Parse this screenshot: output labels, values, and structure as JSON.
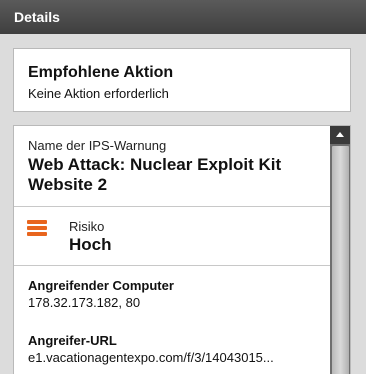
{
  "header": {
    "title": "Details"
  },
  "recommended_action": {
    "title": "Empfohlene Aktion",
    "value": "Keine Aktion erforderlich"
  },
  "details": {
    "warning_label": "Name der IPS-Warnung",
    "warning_name": "Web Attack: Nuclear Exploit Kit Website 2",
    "risk_label": "Risiko",
    "risk_value": "Hoch",
    "risk_icon": "risk-level-icon",
    "risk_color": "#e8651e",
    "attacker_label": "Angreifender Computer",
    "attacker_value": "178.32.173.182, 80",
    "url_label": "Angreifer-URL",
    "url_value": "e1.vacationagentexpo.com/f/3/14043015..."
  },
  "colors": {
    "header_bg": "#4a4a4a",
    "page_bg": "#dcdcdc",
    "scrollbar_track": "#6e6e6e"
  }
}
